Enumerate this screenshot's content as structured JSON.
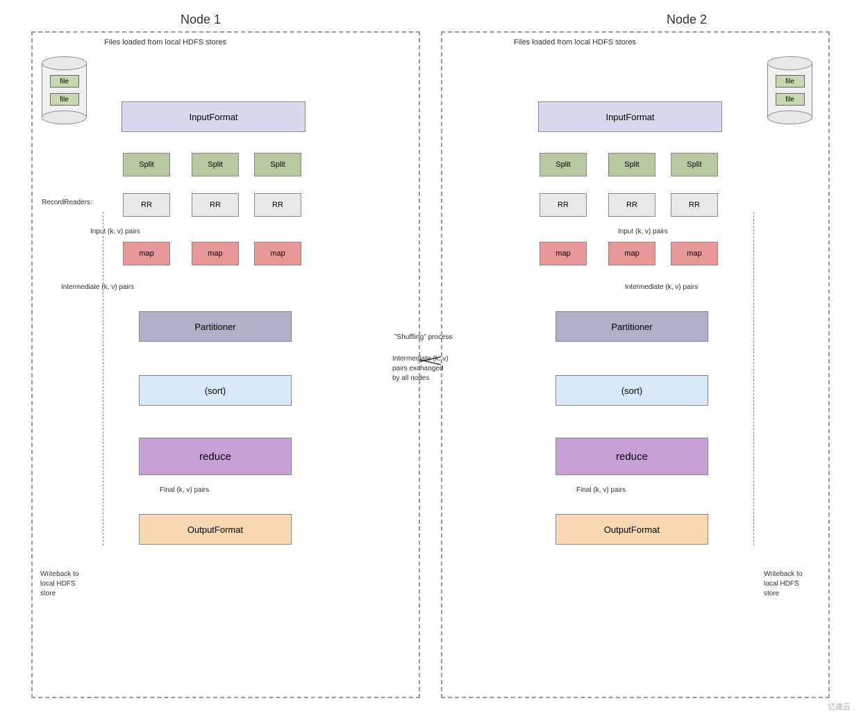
{
  "nodes": [
    {
      "id": "node1",
      "title": "Node 1",
      "hdfs_label": "Files loaded from local HDFS stores",
      "record_readers_label": "RecordReaders:",
      "input_kv_label": "Input (k, v) pairs",
      "intermediate_kv_label": "Intermediate (k, v) pairs",
      "final_kv_label": "Final (k, v) pairs",
      "writeback_label": "Writeback to\nlocal HDFS\nstore",
      "input_format": "InputFormat",
      "splits": [
        "Split",
        "Split",
        "Split"
      ],
      "rrs": [
        "RR",
        "RR",
        "RR"
      ],
      "maps": [
        "map",
        "map",
        "map"
      ],
      "partitioner": "Partitioner",
      "sort": "(sort)",
      "reduce": "reduce",
      "output_format": "OutputFormat",
      "files": [
        "file",
        "file"
      ]
    },
    {
      "id": "node2",
      "title": "Node 2",
      "hdfs_label": "Files loaded from local HDFS stores",
      "record_readers_label": "",
      "input_kv_label": "Input (k, v) pairs",
      "intermediate_kv_label": "Intermediate (k, v) pairs",
      "final_kv_label": "Final (k, v) pairs",
      "writeback_label": "Writeback to\nlocal HDFS\nstore",
      "input_format": "InputFormat",
      "splits": [
        "Split",
        "Split",
        "Split"
      ],
      "rrs": [
        "RR",
        "RR",
        "RR"
      ],
      "maps": [
        "map",
        "map",
        "map"
      ],
      "partitioner": "Partitioner",
      "sort": "(sort)",
      "reduce": "reduce",
      "output_format": "OutputFormat",
      "files": [
        "file",
        "file"
      ]
    }
  ],
  "shuffling_label": "\"Shuffling\" process",
  "shuffling_sub_label": "Intermediate (k, v)\npairs exchanged\nby all nodes",
  "watermark": "亿速云"
}
